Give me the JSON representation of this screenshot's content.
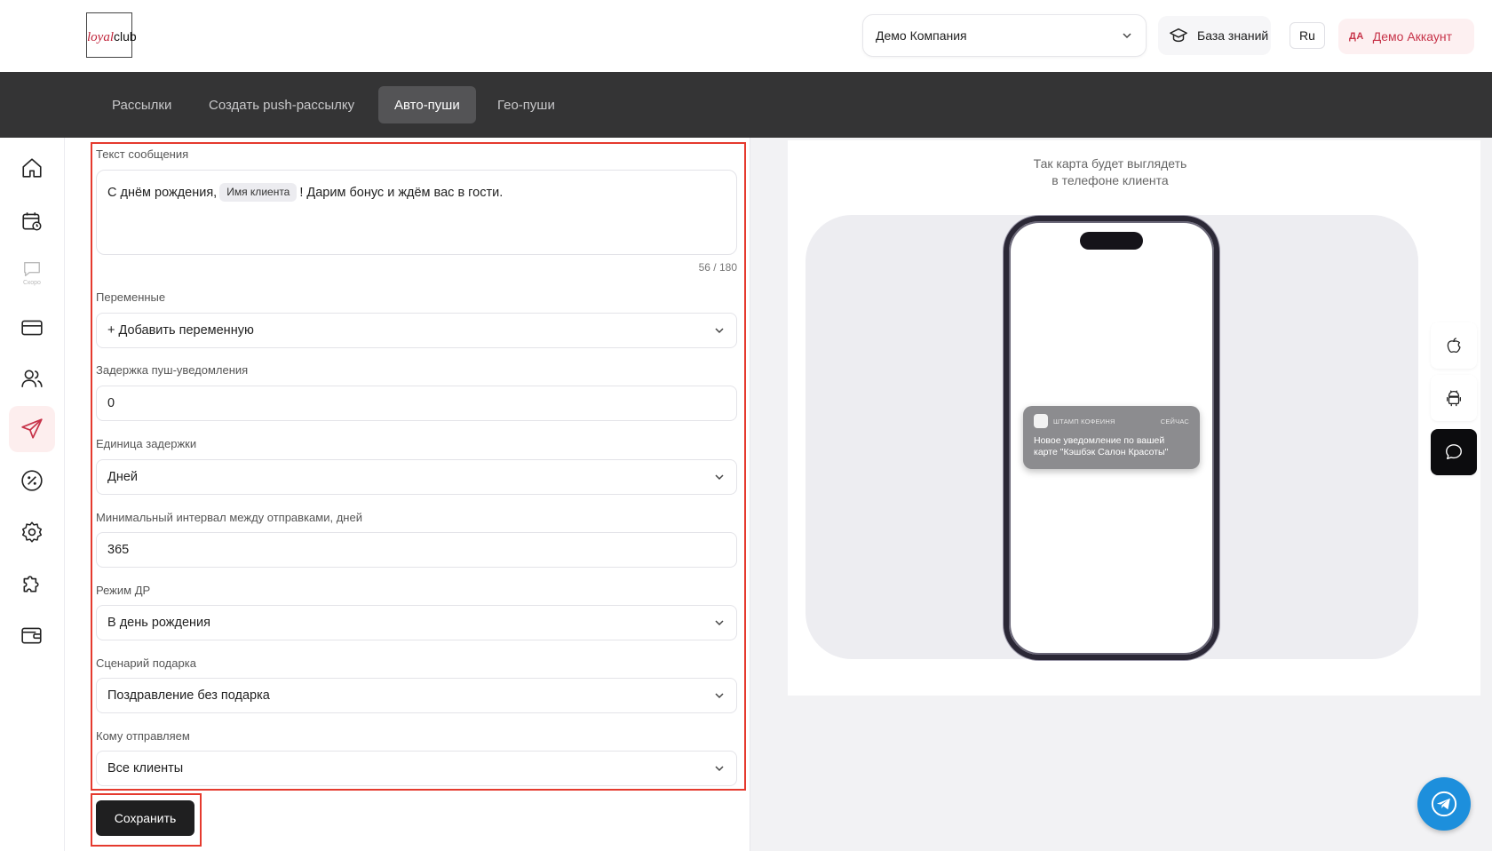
{
  "header": {
    "logo_loyal": "loyal",
    "logo_club": "club",
    "company": "Демо Компания",
    "knowledge_base": "База знаний",
    "language": "Ru",
    "account_initials": "ДА",
    "account_name": "Демо Аккаунт"
  },
  "tabs": [
    {
      "label": "Рассылки",
      "active": false
    },
    {
      "label": "Создать push-рассылку",
      "active": false
    },
    {
      "label": "Авто-пуши",
      "active": true
    },
    {
      "label": "Гео-пуши",
      "active": false
    }
  ],
  "sidebar": {
    "items": [
      {
        "icon": "home-icon"
      },
      {
        "icon": "calendar-icon"
      },
      {
        "icon": "chat-icon",
        "badge": "Скоро"
      },
      {
        "icon": "card-icon"
      },
      {
        "icon": "users-icon"
      },
      {
        "icon": "send-icon",
        "active": true
      },
      {
        "icon": "percent-icon"
      },
      {
        "icon": "gear-icon"
      },
      {
        "icon": "puzzle-icon"
      },
      {
        "icon": "wallet-icon"
      }
    ]
  },
  "form": {
    "message_label": "Текст сообщения",
    "message_before": "С днём рождения,",
    "message_chip": "Имя клиента",
    "message_after": "! Дарим бонус и ждём вас в гости.",
    "counter": "56 / 180",
    "variables_label": "Переменные",
    "variables_value": "+ Добавить переменную",
    "delay_label": "Задержка пуш-уведомления",
    "delay_value": "0",
    "unit_label": "Единица задержки",
    "unit_value": "Дней",
    "interval_label": "Минимальный интервал между отправками, дней",
    "interval_value": "365",
    "mode_label": "Режим ДР",
    "mode_value": "В день рождения",
    "scenario_label": "Сценарий подарка",
    "scenario_value": "Поздравление без подарка",
    "recipients_label": "Кому отправляем",
    "recipients_value": "Все клиенты",
    "save_label": "Сохранить"
  },
  "preview": {
    "caption_line1": "Так карта будет выглядеть",
    "caption_line2": "в телефоне клиента",
    "notif_app": "ШТАМП КОФЕИНЯ",
    "notif_time": "СЕЙЧАС",
    "notif_text": "Новое уведомление по вашей карте \"Кэшбэк Салон Красоты\""
  },
  "colors": {
    "accent": "#c73349",
    "highlight": "#e53a2e",
    "navbar": "#343435",
    "telegram": "#1d8fdc"
  }
}
